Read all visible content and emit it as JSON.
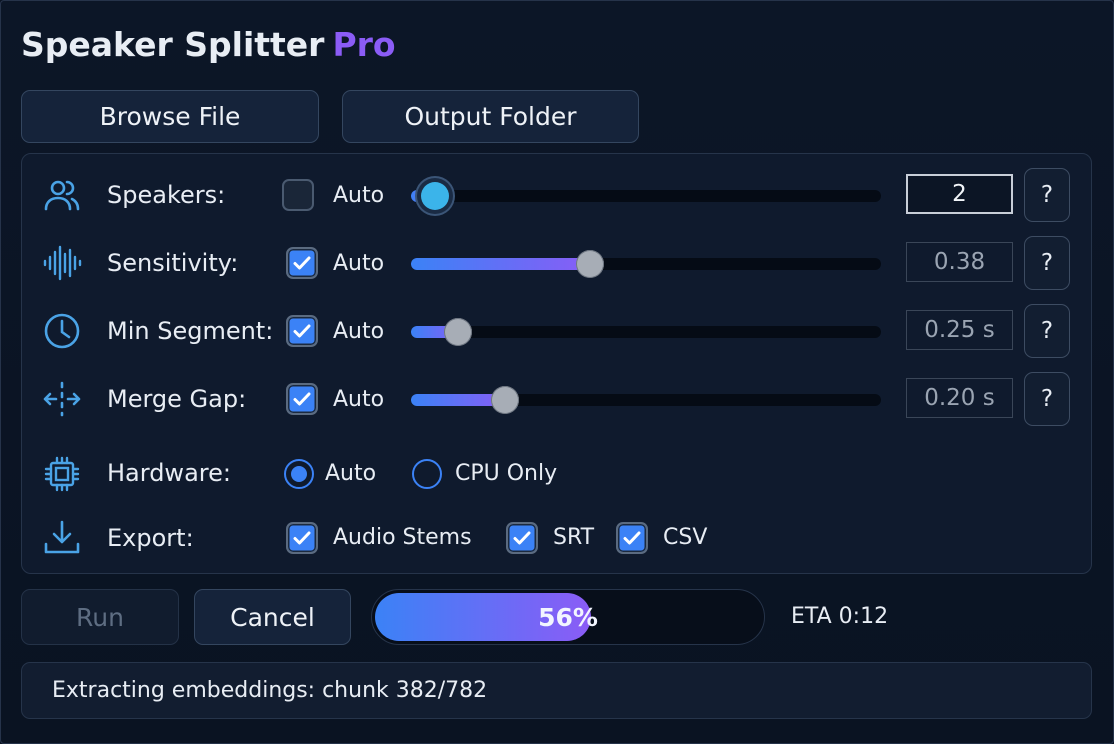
{
  "app": {
    "title": "Speaker Splitter",
    "edition": "Pro"
  },
  "toolbar": {
    "browse_label": "Browse File",
    "output_label": "Output Folder"
  },
  "settings": {
    "auto_label": "Auto",
    "speakers": {
      "label": "Speakers:",
      "auto": false,
      "value": "2",
      "slider": 0.05,
      "help": "?"
    },
    "sensitivity": {
      "label": "Sensitivity:",
      "auto": true,
      "value": "0.38",
      "slider": 0.38,
      "help": "?"
    },
    "min_segment": {
      "label": "Min Segment:",
      "auto": true,
      "value": "0.25 s",
      "slider": 0.1,
      "help": "?"
    },
    "merge_gap": {
      "label": "Merge Gap:",
      "auto": true,
      "value": "0.20 s",
      "slider": 0.2,
      "help": "?"
    },
    "hardware": {
      "label": "Hardware:",
      "options": [
        "Auto",
        "CPU Only"
      ],
      "selected": "Auto"
    },
    "export": {
      "label": "Export:",
      "options": [
        {
          "label": "Audio Stems",
          "checked": true
        },
        {
          "label": "SRT",
          "checked": true
        },
        {
          "label": "CSV",
          "checked": true
        }
      ]
    }
  },
  "actions": {
    "run_label": "Run",
    "cancel_label": "Cancel"
  },
  "progress": {
    "percent": 56,
    "label": "56%",
    "eta": "ETA 0:12"
  },
  "status": {
    "text": "Extracting embeddings: chunk 382/782"
  },
  "colors": {
    "accent_blue": "#3b82f6",
    "accent_purple": "#8b5cf6",
    "icon_blue": "#4aa3e6",
    "background": "#0a1322"
  }
}
